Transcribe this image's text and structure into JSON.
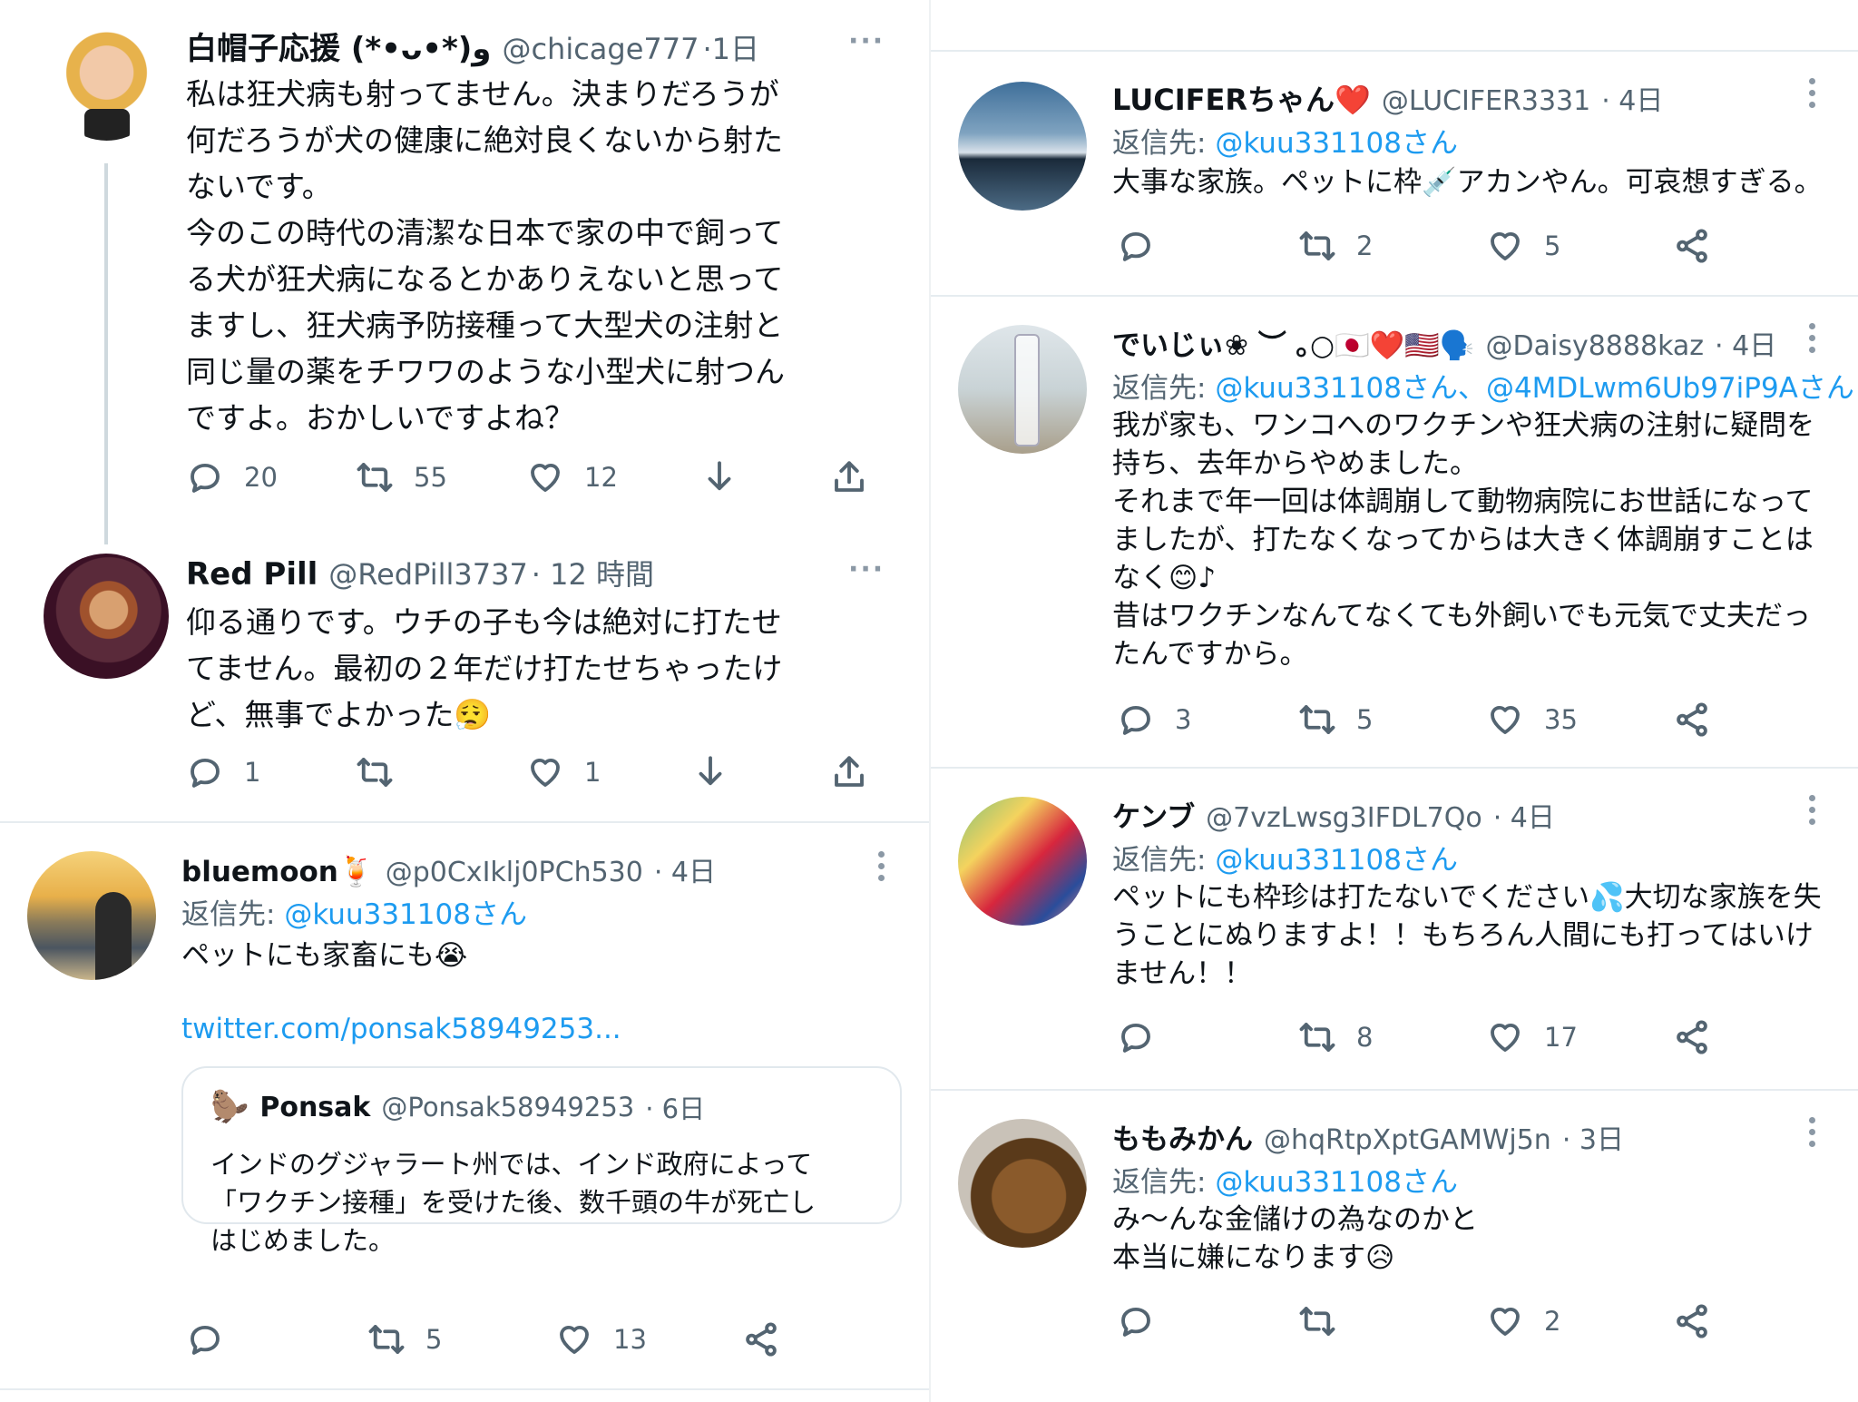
{
  "left": {
    "t1": {
      "name": "白帽子応援 (*•ᴗ•*)و",
      "handle": "@chicage777",
      "time": "·1日",
      "body": "私は狂犬病も射ってません。決まりだろうが\n何だろうが犬の健康に絶対良くないから射た\nないです。\n今のこの時代の清潔な日本で家の中で飼って\nる犬が狂犬病になるとかありえないと思って\nますし、狂犬病予防接種って大型犬の注射と\n同じ量の薬をチワワのような小型犬に射つん\nですよ。おかしいですよね？",
      "replies": "20",
      "retweets": "55",
      "likes": "12"
    },
    "t2": {
      "name": "Red Pill",
      "handle": "@RedPill3737",
      "time": "· 12 時間",
      "body": "仰る通りです。ウチの子も今は絶対に打たせ\nてません。最初の２年だけ打たせちゃったけ\nど、無事でよかった",
      "emoji": "😮‍💨",
      "replies": "1",
      "retweets": "",
      "likes": "1"
    },
    "t3": {
      "name": "bluemoon",
      "name_emoji": "🍹",
      "handle": "@p0CxIklj0PCh530",
      "time": "· 4日",
      "reply_label": "返信先: ",
      "reply_to": "@kuu331108さん",
      "body": "ペットにも家畜にも",
      "emoji": "😭",
      "link": "twitter.com/ponsak58949253...",
      "quote": {
        "avatar_emoji": "🦫",
        "name": "Ponsak",
        "handle": "@Ponsak58949253",
        "time": "· 6日",
        "body": "インドのグジャラート州では、インド政府によって\n「ワクチン接種」を受けた後、数千頭の牛が死亡し\nはじめました。"
      },
      "replies": "",
      "retweets": "5",
      "likes": "13"
    }
  },
  "right": {
    "r1": {
      "name": "LUCIFERちゃん",
      "name_emoji": "❤️",
      "handle": "@LUCIFER3331",
      "time": "· 4日",
      "reply_label": "返信先: ",
      "reply_to": "@kuu331108さん",
      "body": "大事な家族。ペットに枠💉アカンやん。可哀想すぎる。",
      "replies": "",
      "retweets": "2",
      "likes": "5"
    },
    "r2": {
      "name": "でいじぃ❀ ︶ ｡○🇯🇵❤️🇺🇸🗣️",
      "handle": "@Daisy8888kaz",
      "time": "· 4日",
      "reply_label": "返信先: ",
      "reply_to": "@kuu331108さん、@4MDLwm6Ub97iP9Aさん",
      "body": "我が家も、ワンコへのワクチンや狂犬病の注射に疑問を\n持ち、去年からやめました。\nそれまで年一回は体調崩して動物病院にお世話になって\nましたが、打たなくなってからは大きく体調崩すことは\nなく😊♪\n昔はワクチンなんてなくても外飼いでも元気で丈夫だっ\nたんですから。",
      "replies": "3",
      "retweets": "5",
      "likes": "35"
    },
    "r3": {
      "name": "ケンブ",
      "handle": "@7vzLwsg3IFDL7Qo",
      "time": "· 4日",
      "reply_label": "返信先: ",
      "reply_to": "@kuu331108さん",
      "body": "ペットにも枠珍は打たないでください💦大切な家族を失\nうことにぬりますよ！！もちろん人間にも打ってはいけ\nません！！",
      "replies": "",
      "retweets": "8",
      "likes": "17"
    },
    "r4": {
      "name": "ももみかん",
      "handle": "@hqRtpXptGAMWj5n",
      "time": "· 3日",
      "reply_label": "返信先: ",
      "reply_to": "@kuu331108さん",
      "body": "み～んな金儲けの為なのかと\n本当に嫌になります😥",
      "replies": "",
      "retweets": "",
      "likes": "2"
    }
  },
  "icons": {
    "reply": "reply-icon",
    "retweet": "retweet-icon",
    "like": "heart-icon",
    "bookmark": "download-icon",
    "share": "share-icon",
    "more": "more-icon"
  }
}
